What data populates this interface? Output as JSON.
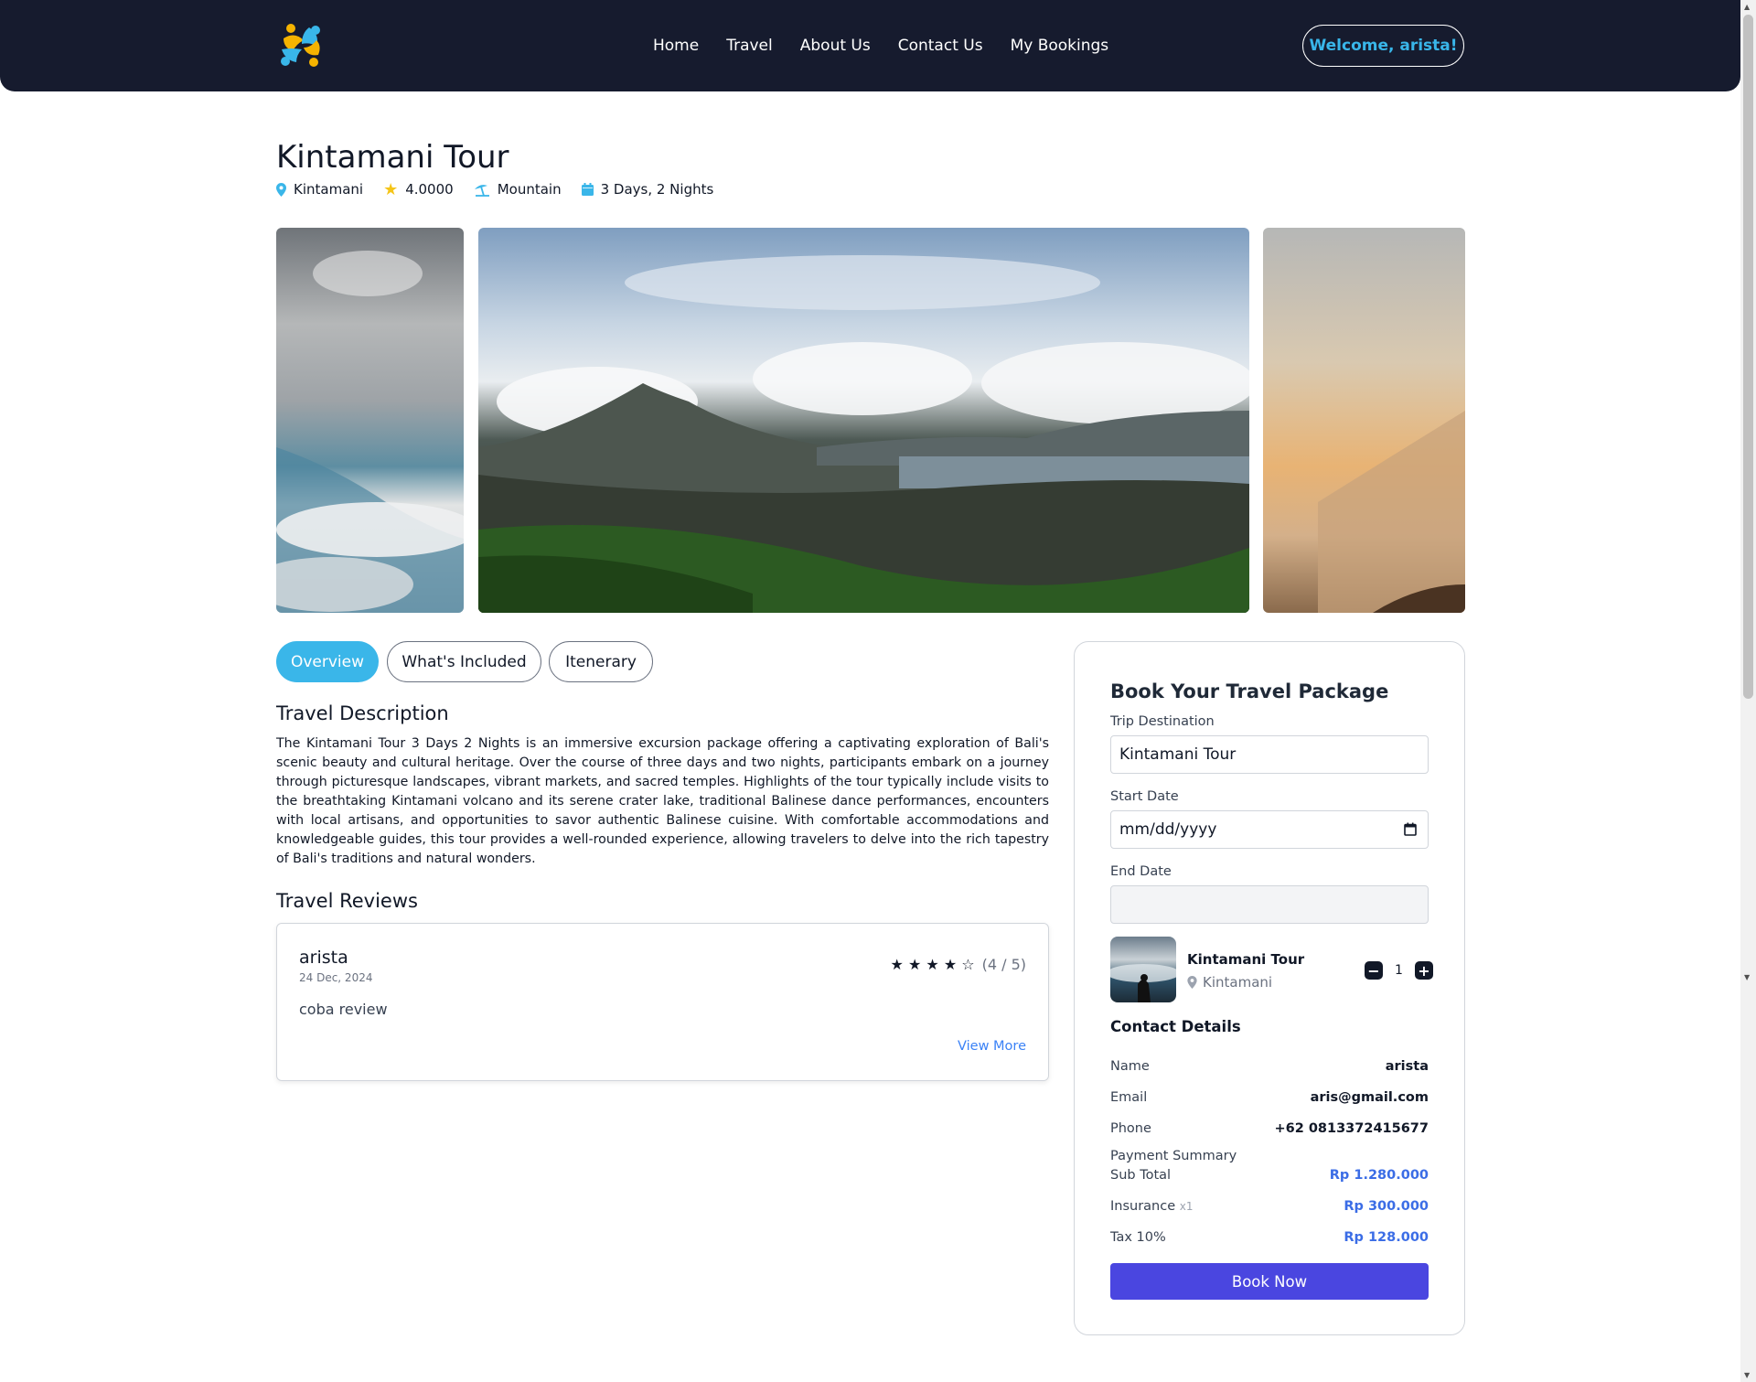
{
  "nav": {
    "links": [
      "Home",
      "Travel",
      "About Us",
      "Contact Us",
      "My Bookings"
    ],
    "welcome": "Welcome, arista!"
  },
  "tour": {
    "title": "Kintamani Tour",
    "location": "Kintamani",
    "rating": "4.0000",
    "category": "Mountain",
    "duration": "3 Days, 2 Nights"
  },
  "tabs": [
    "Overview",
    "What's Included",
    "Itenerary"
  ],
  "description": {
    "title": "Travel Description",
    "text": "The Kintamani Tour 3 Days 2 Nights is an immersive excursion package offering a captivating exploration of Bali's scenic beauty and cultural heritage. Over the course of three days and two nights, participants embark on a journey through picturesque landscapes, vibrant markets, and sacred temples. Highlights of the tour typically include visits to the breathtaking Kintamani volcano and its serene crater lake, traditional Balinese dance performances, encounters with local artisans, and opportunities to savor authentic Balinese cuisine. With comfortable accommodations and knowledgeable guides, this tour provides a well-rounded experience, allowing travelers to delve into the rich tapestry of Bali's traditions and natural wonders."
  },
  "reviews": {
    "title": "Travel Reviews",
    "items": [
      {
        "name": "arista",
        "date": "24 Dec, 2024",
        "text": "coba review",
        "stars": "★ ★ ★ ★ ☆",
        "score": "(4 / 5)",
        "more": "View More"
      }
    ]
  },
  "booking": {
    "title": "Book Your Travel Package",
    "destination_label": "Trip Destination",
    "destination_value": "Kintamani Tour",
    "start_label": "Start Date",
    "start_placeholder": "mm/dd/yyyy",
    "end_label": "End Date",
    "end_value": "",
    "item_name": "Kintamani Tour",
    "item_location": "Kintamani",
    "quantity": "1",
    "contact_title": "Contact Details",
    "contact": [
      {
        "k": "Name",
        "v": "arista"
      },
      {
        "k": "Email",
        "v": "aris@gmail.com"
      },
      {
        "k": "Phone",
        "v": "+62 0813372415677"
      }
    ],
    "payment_title": "Payment Summary",
    "subtotal_label": "Sub Total",
    "subtotal": "Rp 1.280.000",
    "insurance_label": "Insurance",
    "insurance_qty": "x1",
    "insurance": "Rp 300.000",
    "tax_label": "Tax 10%",
    "tax": "Rp 128.000",
    "book_button": "Book Now"
  },
  "colors": {
    "navbar": "#161b2e",
    "accent": "#3ab6e9",
    "button": "#4a46e0",
    "price": "#3b6de6"
  }
}
